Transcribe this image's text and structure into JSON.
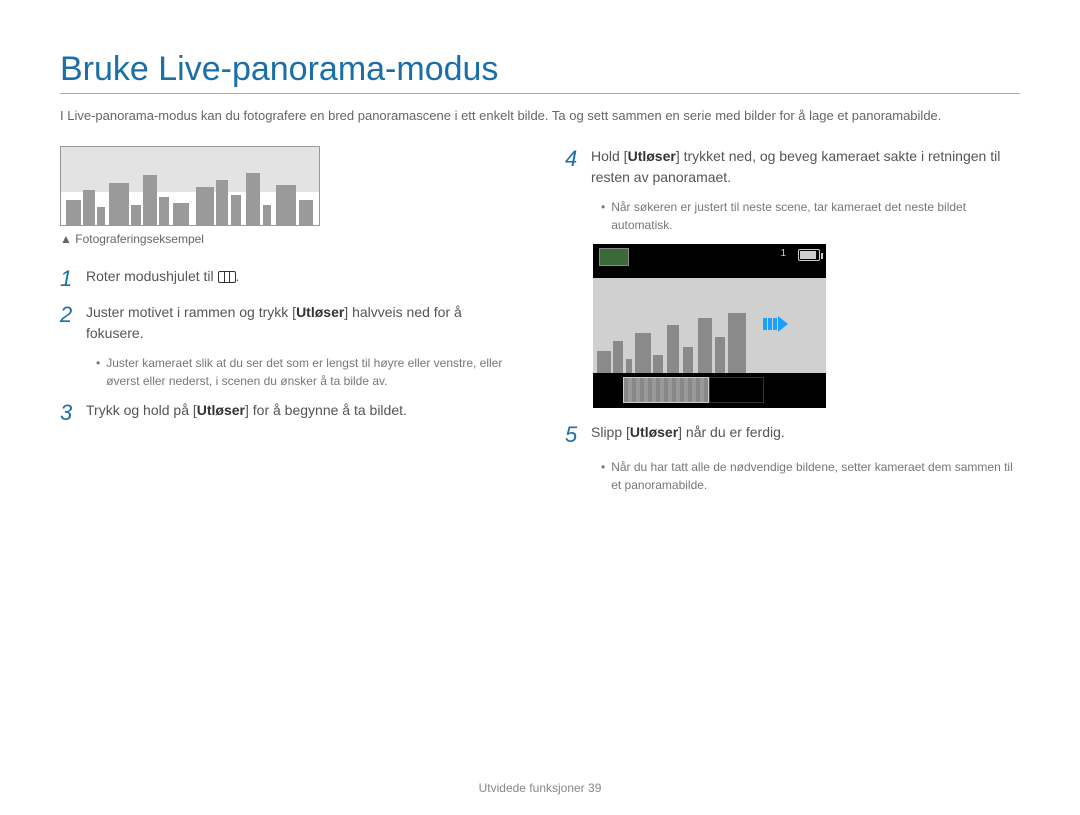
{
  "title": "Bruke Live-panorama-modus",
  "intro": "I Live-panorama-modus kan du fotografere en bred panoramascene i ett enkelt bilde. Ta og sett sammen en serie med bilder for å lage et panoramabilde.",
  "example_caption_arrow": "▲",
  "example_caption": "Fotograferingseksempel",
  "lcd": {
    "top_number": "1"
  },
  "steps": {
    "s1": {
      "num": "1",
      "pre": "Roter modushjulet til ",
      "post": "."
    },
    "s2": {
      "num": "2",
      "pre": "Juster motivet i rammen og trykk [",
      "bold": "Utløser",
      "post": "] halvveis ned for å fokusere.",
      "bullet": "Juster kameraet slik at du ser det som er lengst til høyre eller venstre, eller øverst eller nederst, i scenen du ønsker å ta bilde av."
    },
    "s3": {
      "num": "3",
      "pre": "Trykk og hold på [",
      "bold": "Utløser",
      "post": "] for å begynne å ta bildet."
    },
    "s4": {
      "num": "4",
      "pre": "Hold [",
      "bold": "Utløser",
      "post": "] trykket ned, og beveg kameraet sakte i retningen til resten av panoramaet.",
      "bullet": "Når søkeren er justert til neste scene, tar kameraet det neste bildet automatisk."
    },
    "s5": {
      "num": "5",
      "pre": "Slipp [",
      "bold": "Utløser",
      "post": "] når du er ferdig.",
      "bullet": "Når du har tatt alle de nødvendige bildene, setter kameraet dem sammen til et panoramabilde."
    }
  },
  "footer": {
    "section": "Utvidede funksjoner",
    "page": "39"
  }
}
